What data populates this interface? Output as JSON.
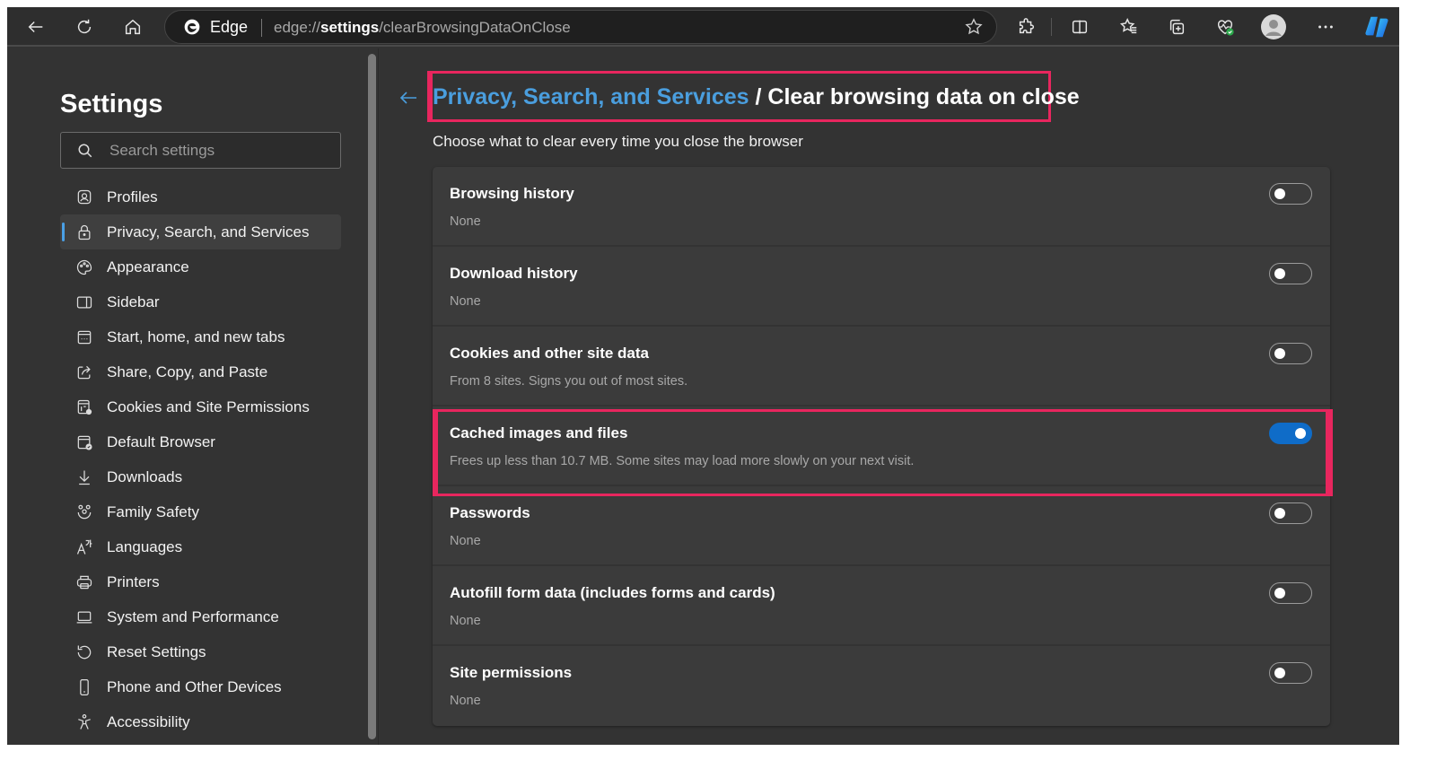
{
  "toolbar": {
    "address_label": "Edge",
    "url_prefix": "edge://",
    "url_bold": "settings",
    "url_suffix": "/clearBrowsingDataOnClose",
    "icons": [
      "back-icon",
      "refresh-icon",
      "home-icon",
      "favorite-star-icon",
      "extensions-icon",
      "split-screen-icon",
      "favorites-icon",
      "collections-icon",
      "browser-essentials-icon",
      "profile-avatar",
      "more-icon",
      "copilot-icon"
    ]
  },
  "sidebar": {
    "title": "Settings",
    "search_placeholder": "Search settings",
    "items": [
      {
        "label": "Profiles",
        "icon": "profiles-icon"
      },
      {
        "label": "Privacy, Search, and Services",
        "icon": "lock-icon",
        "active": true
      },
      {
        "label": "Appearance",
        "icon": "palette-icon"
      },
      {
        "label": "Sidebar",
        "icon": "sidebar-icon"
      },
      {
        "label": "Start, home, and new tabs",
        "icon": "start-page-icon"
      },
      {
        "label": "Share, Copy, and Paste",
        "icon": "share-icon"
      },
      {
        "label": "Cookies and Site Permissions",
        "icon": "cookies-settings-icon"
      },
      {
        "label": "Default Browser",
        "icon": "default-browser-icon"
      },
      {
        "label": "Downloads",
        "icon": "download-icon"
      },
      {
        "label": "Family Safety",
        "icon": "family-icon"
      },
      {
        "label": "Languages",
        "icon": "languages-icon"
      },
      {
        "label": "Printers",
        "icon": "printer-icon"
      },
      {
        "label": "System and Performance",
        "icon": "laptop-icon"
      },
      {
        "label": "Reset Settings",
        "icon": "reset-icon"
      },
      {
        "label": "Phone and Other Devices",
        "icon": "phone-icon"
      },
      {
        "label": "Accessibility",
        "icon": "accessibility-icon"
      }
    ]
  },
  "main": {
    "breadcrumb_parent": "Privacy, Search, and Services",
    "breadcrumb_separator": " / ",
    "breadcrumb_current": "Clear browsing data on close",
    "subtitle": "Choose what to clear every time you close the browser",
    "rows": [
      {
        "title": "Browsing history",
        "desc": "None",
        "enabled": false
      },
      {
        "title": "Download history",
        "desc": "None",
        "enabled": false
      },
      {
        "title": "Cookies and other site data",
        "desc": "From 8 sites. Signs you out of most sites.",
        "enabled": false
      },
      {
        "title": "Cached images and files",
        "desc": "Frees up less than 10.7 MB. Some sites may load more slowly on your next visit.",
        "enabled": true,
        "highlighted": true
      },
      {
        "title": "Passwords",
        "desc": "None",
        "enabled": false
      },
      {
        "title": "Autofill form data (includes forms and cards)",
        "desc": "None",
        "enabled": false
      },
      {
        "title": "Site permissions",
        "desc": "None",
        "enabled": false
      }
    ]
  },
  "colors": {
    "accent": "#0f6cc8",
    "link": "#4a9ede",
    "highlight_annotation": "#e8265e",
    "background": "#333333",
    "card": "#3b3b3b"
  }
}
